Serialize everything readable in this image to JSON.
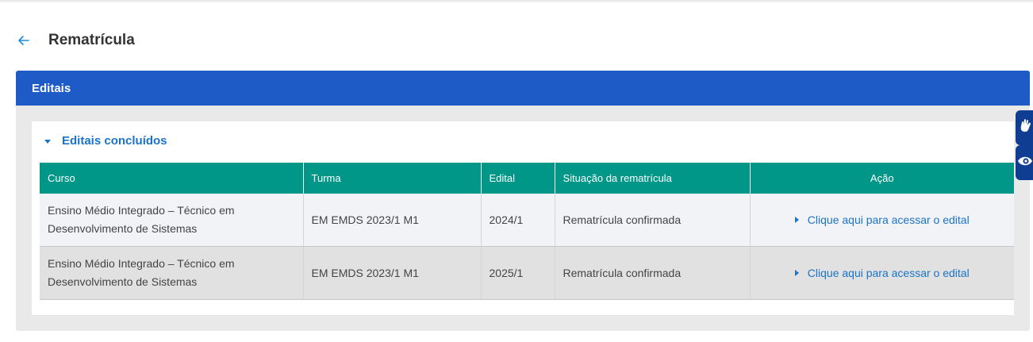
{
  "page": {
    "title": "Rematrícula"
  },
  "panel": {
    "header": "Editais",
    "accordion_title": "Editais concluídos"
  },
  "table": {
    "columns": [
      "Curso",
      "Turma",
      "Edital",
      "Situação da rematrícula",
      "Ação"
    ],
    "rows": [
      {
        "curso": "Ensino Médio Integrado – Técnico em Desenvolvimento de Sistemas",
        "turma": "EM EMDS 2023/1 M1",
        "edital": "2024/1",
        "situacao": "Rematrícula confirmada",
        "acao": "Clique aqui para acessar o edital"
      },
      {
        "curso": "Ensino Médio Integrado – Técnico em Desenvolvimento de Sistemas",
        "turma": "EM EMDS 2023/1 M1",
        "edital": "2025/1",
        "situacao": "Rematrícula confirmada",
        "acao": "Clique aqui para acessar o edital"
      }
    ]
  },
  "widgets": {
    "sign_language": "hand-sign-icon",
    "low_vision": "eye-icon"
  },
  "colors": {
    "header_blue": "#1e5bc6",
    "table_header_teal": "#009688",
    "link_blue": "#1a73c8",
    "widget_navy": "#0f3d91"
  }
}
